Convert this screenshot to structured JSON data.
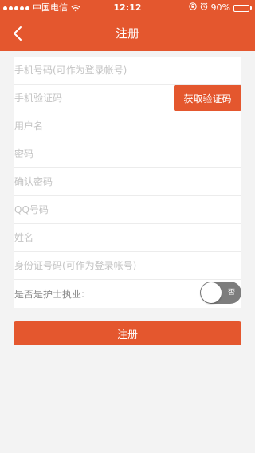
{
  "status_bar": {
    "carrier": "中国电信",
    "time": "12:12",
    "battery": "90%",
    "battery_level": 0.9
  },
  "nav": {
    "title": "注册"
  },
  "form": {
    "phone_placeholder": "手机号码(可作为登录帐号)",
    "code_placeholder": "手机验证码",
    "get_code_label": "获取验证码",
    "username_placeholder": "用户名",
    "password_placeholder": "密码",
    "confirm_password_placeholder": "确认密码",
    "qq_placeholder": "QQ号码",
    "name_placeholder": "姓名",
    "id_card_placeholder": "身份证号码(可作为登录帐号)",
    "nurse_label": "是否是护士执业:",
    "nurse_toggle_text": "否"
  },
  "submit_label": "注册",
  "colors": {
    "accent": "#e4572e",
    "background": "#f3f3f3",
    "toggle_off": "#7d7d7d"
  }
}
